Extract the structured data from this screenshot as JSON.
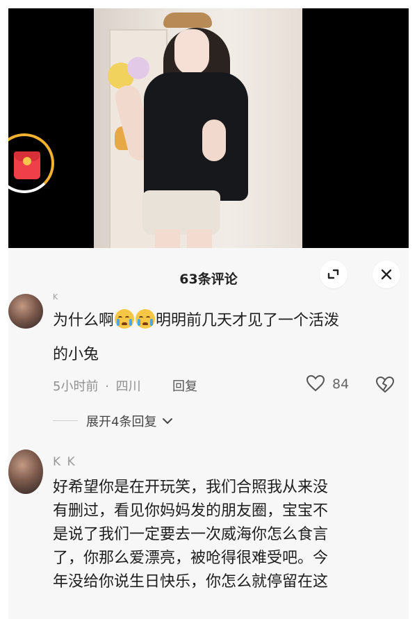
{
  "panel": {
    "title": "63条评论"
  },
  "comments": [
    {
      "username": "K",
      "text_before_emoji": "为什么啊",
      "text_after_emoji": "明明前几天才见了一个活泼",
      "text_line2": "的小兔",
      "time": "5小时前",
      "separator": "·",
      "location": "四川",
      "reply_label": "回复",
      "likes": "84",
      "expand_label": "展开4条回复"
    },
    {
      "username": "K K",
      "lines": [
        "好希望你是在开玩笑，我们合照我从来没",
        "有删过，看见你妈妈发的朋友圈，宝宝不",
        "是说了我们一定要去一次威海你怎么食言",
        "了，你那么爱漂亮，被呛得很难受吧。今",
        "年没给你说生日快乐，你怎么就停留在这"
      ]
    }
  ],
  "icons": {
    "fullscreen": "expand-icon",
    "close": "close-icon",
    "like": "heart-icon",
    "dislike": "broken-heart-icon",
    "red_packet": "red-envelope-icon",
    "chevron": "chevron-down-icon"
  },
  "colors": {
    "panel_bg": "#f7f7f7",
    "video_bg": "#000000",
    "red_packet": "#ef4049",
    "progress_ring": "#f2b230"
  }
}
